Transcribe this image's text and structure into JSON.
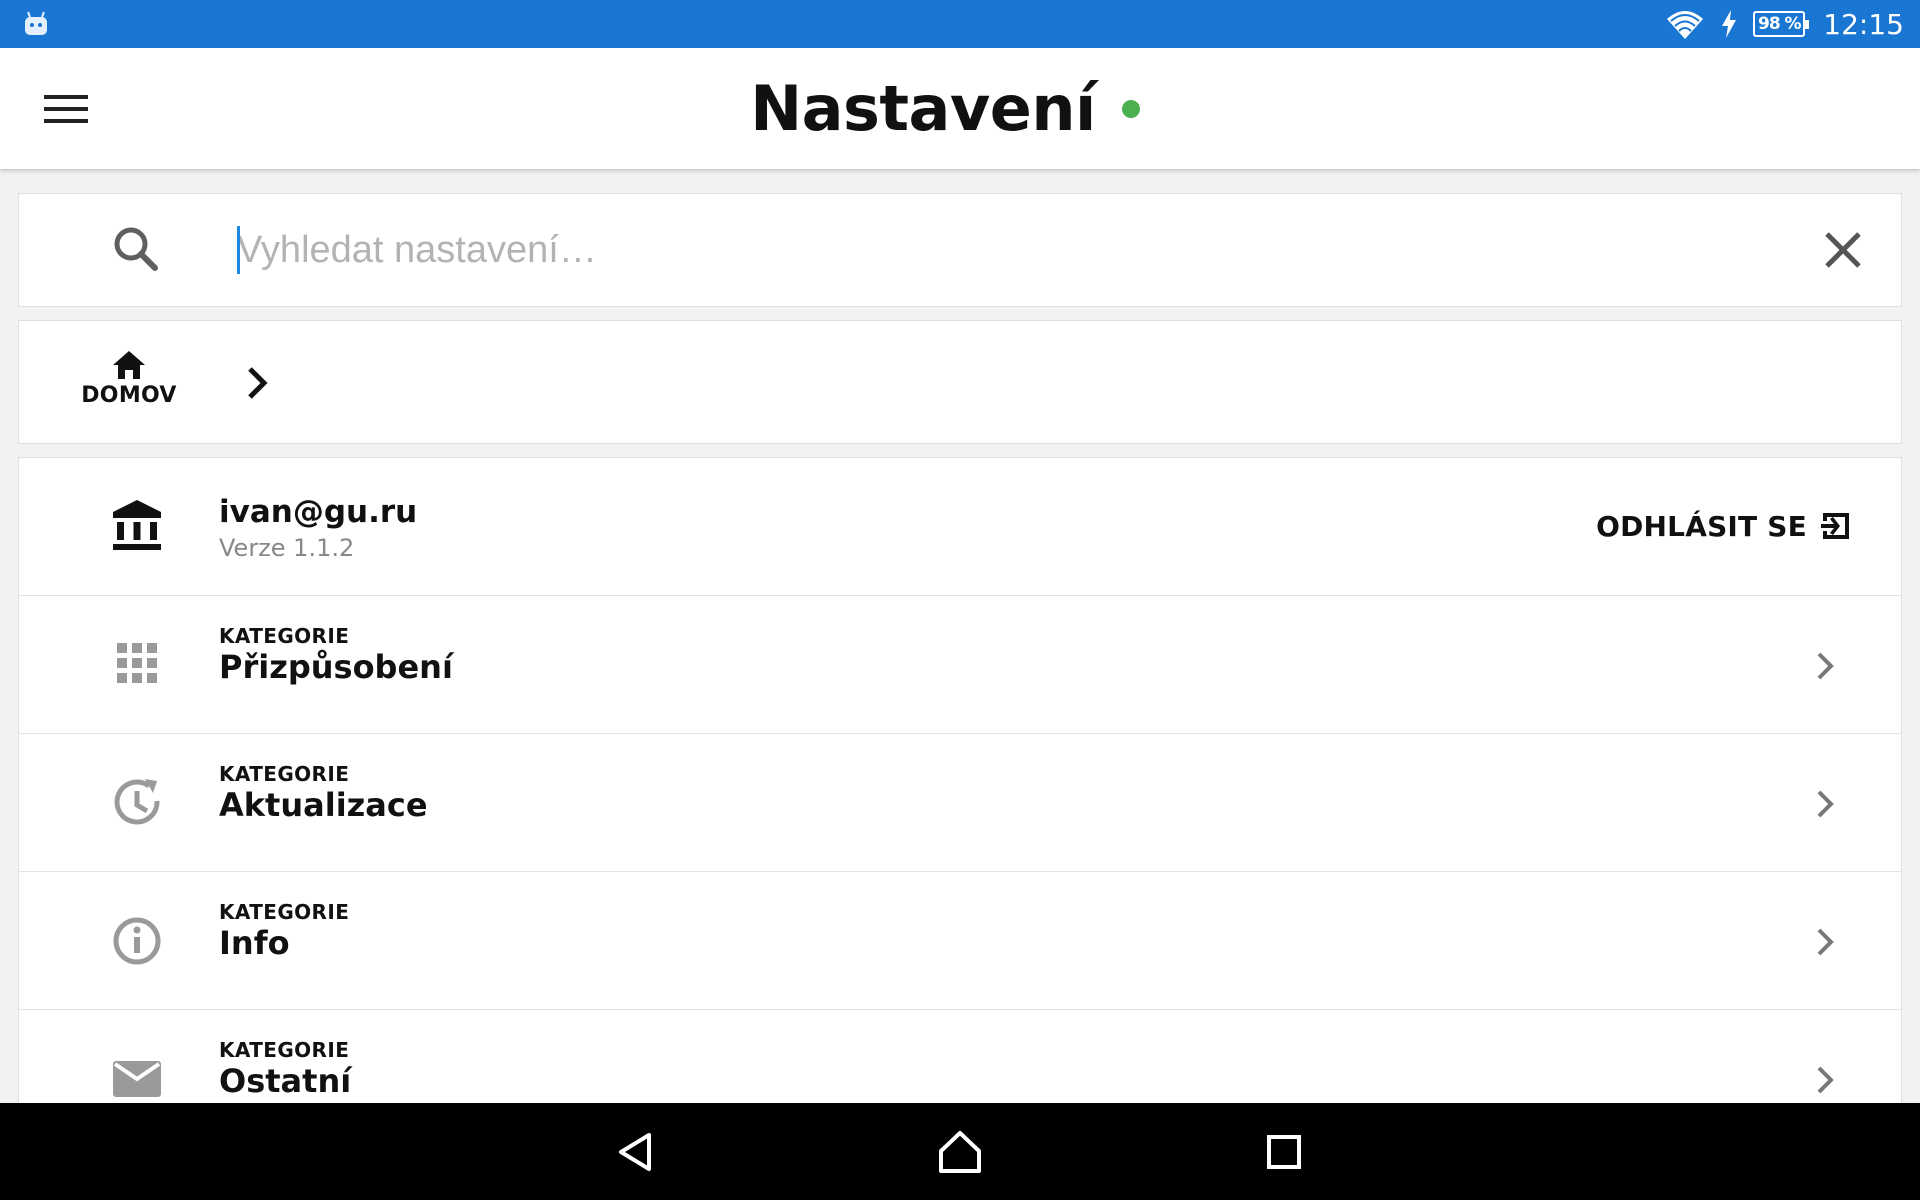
{
  "status_bar": {
    "battery": "98 %",
    "time": "12:15",
    "icons": [
      "app-notification-icon",
      "wifi-icon",
      "charging-icon",
      "battery-icon"
    ],
    "color": "#1976d2"
  },
  "header": {
    "title": "Nastavení",
    "status_color": "#4caf50",
    "icons": [
      "menu-icon"
    ]
  },
  "search": {
    "placeholder": "Vyhledat nastavení…",
    "value": "",
    "icons": [
      "search-icon",
      "close-icon"
    ]
  },
  "breadcrumb": {
    "home_label": "DOMOV",
    "icons": [
      "home-icon",
      "chevron-right-icon"
    ]
  },
  "account": {
    "email": "ivan@gu.ru",
    "version": "Verze 1.1.2",
    "logout_label": "ODHLÁSIT SE",
    "icons": [
      "bank-icon",
      "logout-icon"
    ]
  },
  "categories": [
    {
      "caption": "KATEGORIE",
      "name": "Přizpůsobení",
      "icon": "apps-grid-icon"
    },
    {
      "caption": "KATEGORIE",
      "name": "Aktualizace",
      "icon": "update-clock-icon"
    },
    {
      "caption": "KATEGORIE",
      "name": "Info",
      "icon": "info-icon"
    },
    {
      "caption": "KATEGORIE",
      "name": "Ostatní",
      "icon": "mail-icon"
    }
  ],
  "nav_bar": {
    "icons": [
      "back-icon",
      "home-nav-icon",
      "recents-icon"
    ]
  }
}
